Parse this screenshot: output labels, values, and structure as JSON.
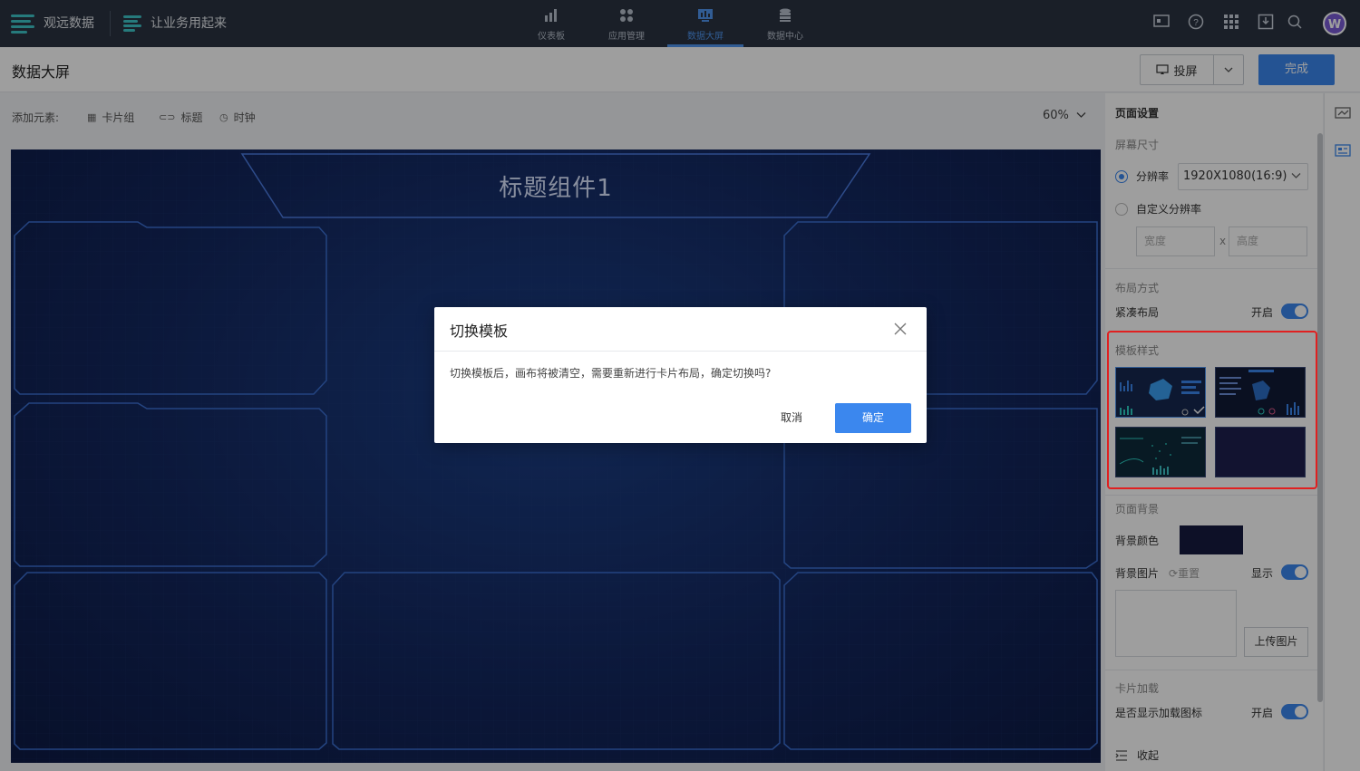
{
  "nav": {
    "brand1": "观远数据",
    "brand2": "让业务用起来",
    "tabs": [
      {
        "label": "仪表板",
        "icon": "bar-chart-icon"
      },
      {
        "label": "应用管理",
        "icon": "apps-icon"
      },
      {
        "label": "数据大屏",
        "icon": "screen-icon",
        "active": true
      },
      {
        "label": "数据中心",
        "icon": "database-icon"
      }
    ],
    "tools": [
      "monitor-icon",
      "help-icon",
      "grid-icon",
      "download-icon",
      "search-icon"
    ],
    "avatar": "W"
  },
  "header": {
    "title": "数据大屏",
    "cast_label": "投屏",
    "done_label": "完成"
  },
  "toolbar": {
    "add_label": "添加元素:",
    "items": [
      "卡片组",
      "标题",
      "时钟"
    ],
    "zoom": "60%"
  },
  "canvas": {
    "title": "标题组件1"
  },
  "panel": {
    "page_settings": "页面设置",
    "screen_size": "屏幕尺寸",
    "resolution_label": "分辨率",
    "resolution_value": "1920X1080(16:9)",
    "custom_resolution": "自定义分辨率",
    "width_placeholder": "宽度",
    "x_sep": "x",
    "height_placeholder": "高度",
    "layout_title": "布局方式",
    "compact_layout": "紧凑布局",
    "on_label": "开启",
    "template_title": "模板样式",
    "bg_title": "页面背景",
    "bg_color": "背景颜色",
    "bg_image": "背景图片",
    "reset": "重置",
    "show_label": "显示",
    "upload": "上传图片",
    "card_loading": "卡片加载",
    "show_loading_icon": "是否显示加载图标",
    "on_label2": "开启",
    "collapse": "收起"
  },
  "modal": {
    "title": "切换模板",
    "message": "切换模板后，画布将被清空，需要重新进行卡片布局，确定切换吗?",
    "cancel": "取消",
    "confirm": "确定"
  }
}
